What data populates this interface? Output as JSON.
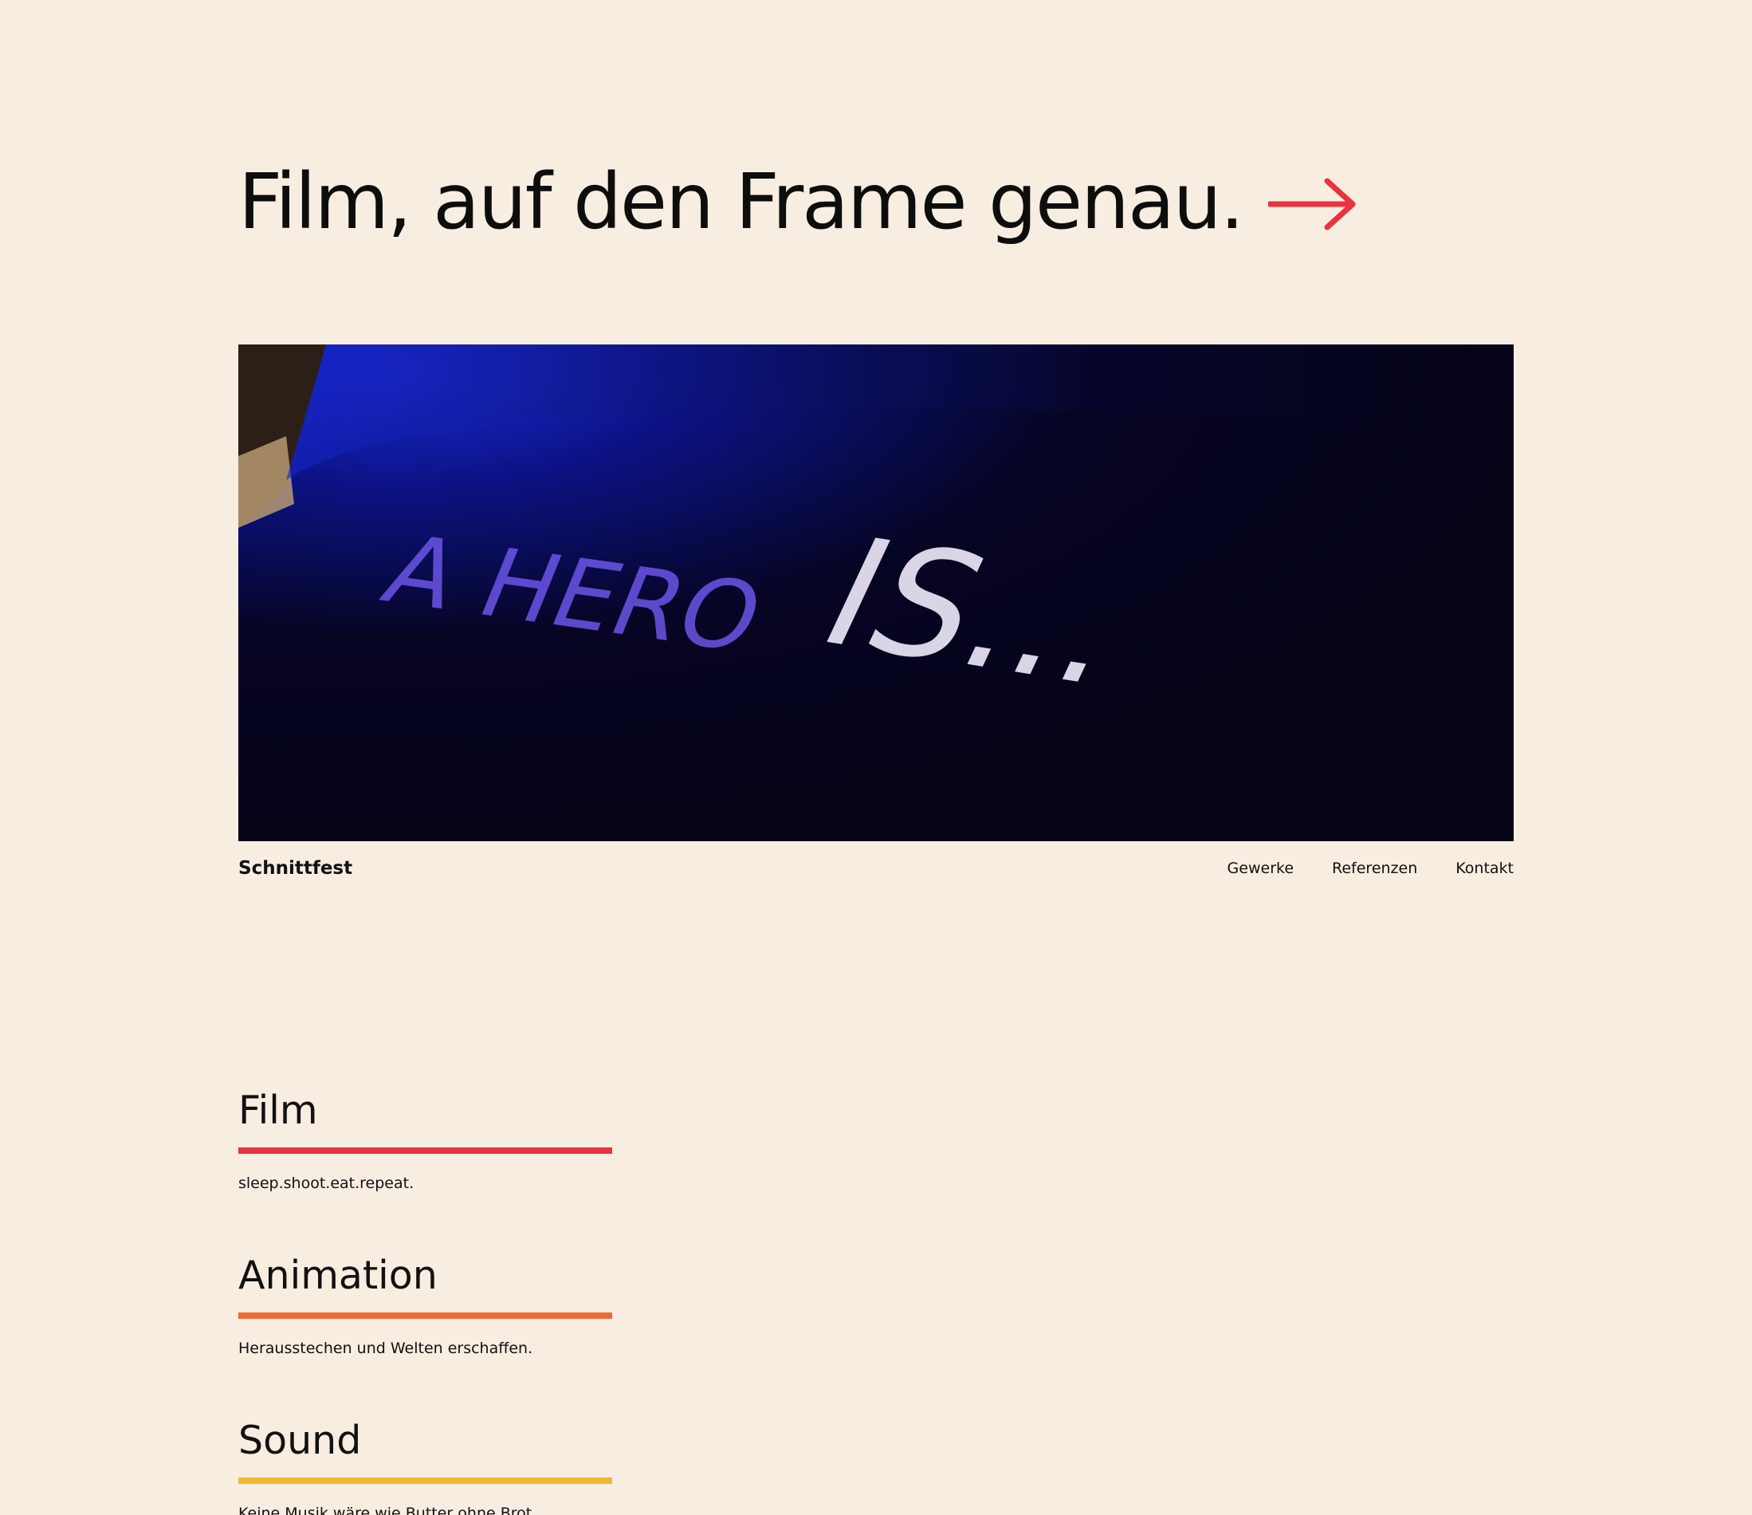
{
  "hero": {
    "title": "Film, auf den Frame genau.",
    "arrow_icon": "arrow-right-icon",
    "arrow_color": "#e8343e"
  },
  "video": {
    "text_line": "A HERO",
    "text_is": "IS..."
  },
  "footer": {
    "brand": "Schnittfest",
    "nav": [
      {
        "label": "Gewerke"
      },
      {
        "label": "Referenzen"
      },
      {
        "label": "Kontakt"
      }
    ]
  },
  "services": [
    {
      "title": "Film",
      "tagline": "sleep.shoot.eat.repeat.",
      "color": "#e23640"
    },
    {
      "title": "Animation",
      "tagline": "Herausstechen und Welten erschaffen.",
      "color": "#f06935"
    },
    {
      "title": "Sound",
      "tagline": "Keine Musik wäre wie Butter ohne Brot.",
      "color": "#f2b833"
    }
  ],
  "colors": {
    "background": "#f7ede1",
    "text": "#111111"
  }
}
